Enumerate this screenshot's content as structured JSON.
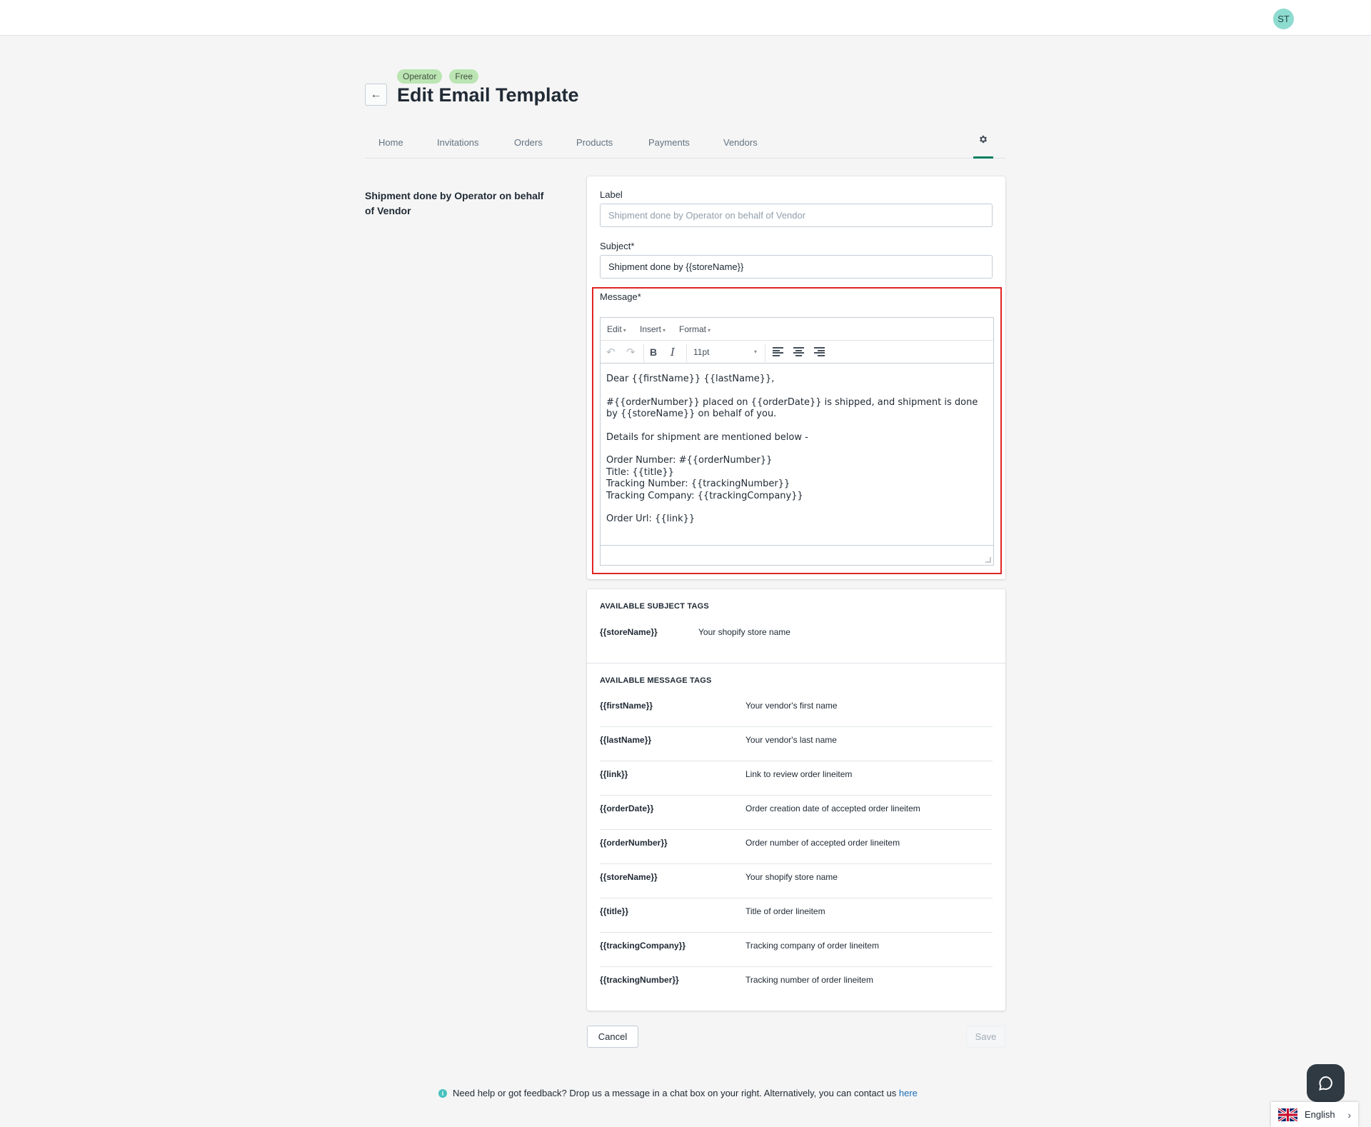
{
  "header": {
    "avatar_initials": "ST"
  },
  "page": {
    "badges": [
      "Operator",
      "Free"
    ],
    "title": "Edit Email Template",
    "back_label": "←"
  },
  "tabs": [
    "Home",
    "Invitations",
    "Orders",
    "Products",
    "Payments",
    "Vendors"
  ],
  "section": {
    "title": "Shipment done by Operator on behalf of Vendor"
  },
  "form": {
    "label_title": "Label",
    "label_placeholder": "Shipment done by Operator on behalf of Vendor",
    "subject_title": "Subject*",
    "subject_value": "Shipment done by {{storeName}}",
    "message_title": "Message*"
  },
  "editor": {
    "menu": [
      "Edit",
      "Insert",
      "Format"
    ],
    "toolbar": {
      "bold": "B",
      "italic": "I",
      "font_size": "11pt"
    },
    "paragraphs": [
      [
        "Dear {{firstName}} {{lastName}},"
      ],
      [
        "#{{orderNumber}} placed on {{orderDate}} is shipped, and shipment is done by {{storeName}} on behalf of you."
      ],
      [
        "Details for shipment are mentioned below -"
      ],
      [
        "Order Number: #{{orderNumber}}",
        "Title: {{title}}",
        "Tracking Number: {{trackingNumber}}",
        "Tracking Company: {{trackingCompany}}"
      ],
      [
        "Order Url: {{link}}"
      ]
    ]
  },
  "tags": {
    "subject_heading": "AVAILABLE SUBJECT TAGS",
    "subject_tags": [
      {
        "name": "{{storeName}}",
        "description": "Your shopify store name"
      }
    ],
    "message_heading": "AVAILABLE MESSAGE TAGS",
    "message_tags": [
      {
        "name": "{{firstName}}",
        "description": "Your vendor's first name"
      },
      {
        "name": "{{lastName}}",
        "description": "Your vendor's last name"
      },
      {
        "name": "{{link}}",
        "description": "Link to review order lineitem"
      },
      {
        "name": "{{orderDate}}",
        "description": "Order creation date of accepted order lineitem"
      },
      {
        "name": "{{orderNumber}}",
        "description": "Order number of accepted order lineitem"
      },
      {
        "name": "{{storeName}}",
        "description": "Your shopify store name"
      },
      {
        "name": "{{title}}",
        "description": "Title of order lineitem"
      },
      {
        "name": "{{trackingCompany}}",
        "description": "Tracking company of order lineitem"
      },
      {
        "name": "{{trackingNumber}}",
        "description": "Tracking number of order lineitem"
      }
    ]
  },
  "actions": {
    "cancel": "Cancel",
    "save": "Save"
  },
  "footer": {
    "text": "Need help or got feedback? Drop us a message in a chat box on your right. Alternatively, you can contact us",
    "link": "here"
  },
  "language": {
    "selected": "English"
  },
  "colors": {
    "accent": "#008060",
    "badge": "#bbe5b3",
    "highlight": "#e02424",
    "link": "#1c6fb9"
  }
}
